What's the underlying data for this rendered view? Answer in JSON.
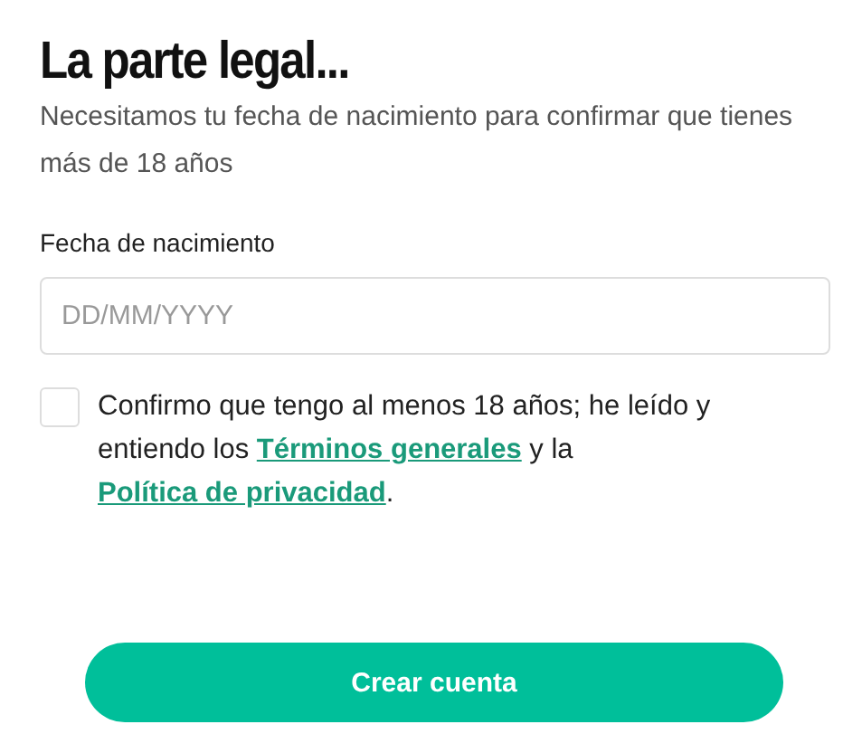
{
  "title": "La parte legal...",
  "subtitle": "Necesitamos tu fecha de nacimiento para confirmar que tienes más de 18 años",
  "birth_date": {
    "label": "Fecha de nacimiento",
    "placeholder": "DD/MM/YYYY"
  },
  "consent": {
    "checked": false,
    "parts": [
      {
        "kind": "text",
        "text": "Confirmo que tengo al menos 18 años; he leído y entiendo los "
      },
      {
        "kind": "link",
        "text": "Términos generales"
      },
      {
        "kind": "text",
        "text": " y la "
      },
      {
        "kind": "link",
        "text": "Política de privacidad"
      },
      {
        "kind": "text",
        "text": "."
      }
    ]
  },
  "button": "Crear cuenta"
}
